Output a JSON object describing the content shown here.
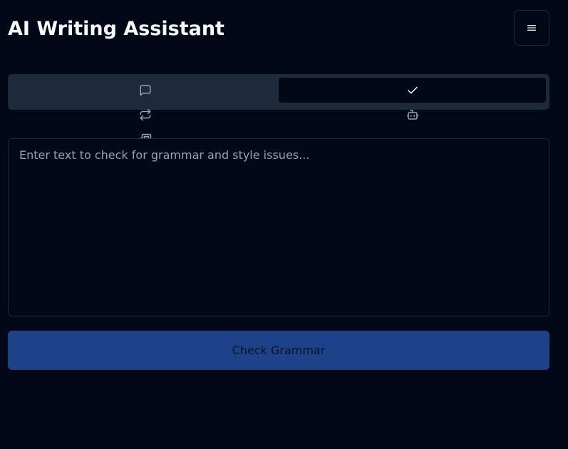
{
  "header": {
    "title": "AI Writing Assistant"
  },
  "menu": {
    "icon": "hamburger-menu-icon"
  },
  "tabs": [
    {
      "id": "chat",
      "icon": "message-square-icon",
      "active": false
    },
    {
      "id": "grammar",
      "icon": "check-icon",
      "active": true
    },
    {
      "id": "rephrase",
      "icon": "repeat-icon",
      "active": false
    },
    {
      "id": "assistant",
      "icon": "bot-icon",
      "active": false
    },
    {
      "id": "summary",
      "icon": "newspaper-icon",
      "active": false
    }
  ],
  "editor": {
    "placeholder": "Enter text to check for grammar and style issues...",
    "value": ""
  },
  "actions": {
    "check_label": "Check Grammar"
  },
  "colors": {
    "background": "#020817",
    "tab_bar": "#1e293b",
    "border": "#1e293b",
    "primary_button": "#1e4289",
    "icon_muted": "#94a3b8",
    "text": "#f8fafc"
  }
}
